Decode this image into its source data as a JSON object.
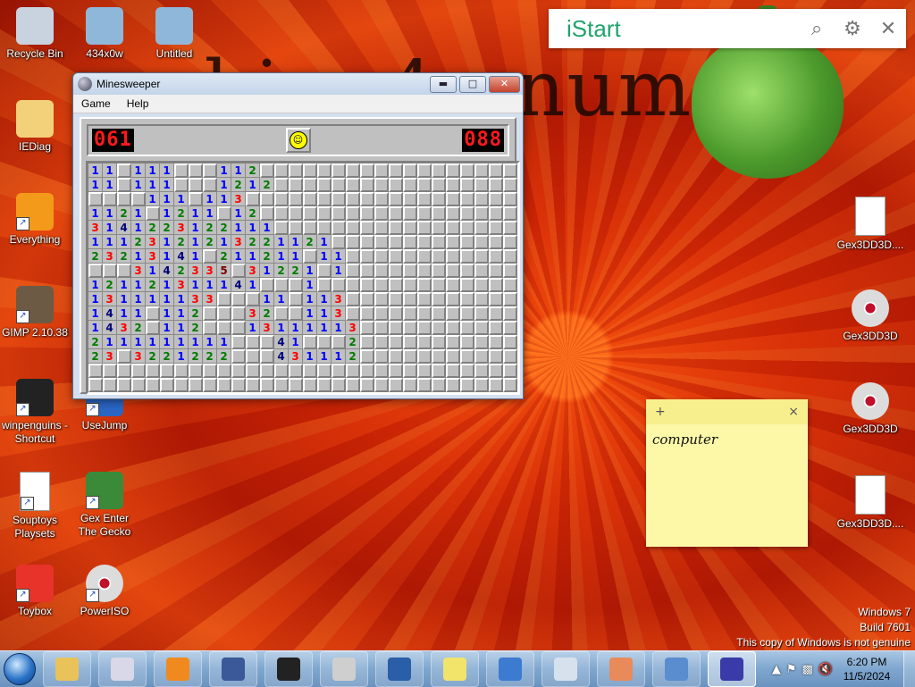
{
  "wallpaper_text": "…hi… 4…num",
  "desktop_icons": [
    {
      "label": "Recycle Bin",
      "icon": "recycle-bin-icon"
    },
    {
      "label": "434x0w",
      "icon": "image-file-icon"
    },
    {
      "label": "Untitled",
      "icon": "image-file-icon"
    },
    {
      "label": "IEDiag",
      "icon": "folder-icon"
    },
    {
      "label": "Everything",
      "icon": "search-app-icon"
    },
    {
      "label": "GIMP 2.10.38",
      "icon": "gimp-icon"
    },
    {
      "label": "winpenguins - Shortcut",
      "icon": "penguin-icon"
    },
    {
      "label": "UseJump",
      "icon": "app-icon"
    },
    {
      "label": "Souptoys Playsets",
      "icon": "document-icon"
    },
    {
      "label": "Gex Enter The Gecko",
      "icon": "gecko-icon"
    },
    {
      "label": "Toybox",
      "icon": "toybox-icon"
    },
    {
      "label": "PowerISO",
      "icon": "disc-icon"
    },
    {
      "label": "Gex3DD3D....",
      "icon": "document-icon"
    },
    {
      "label": "Gex3DD3D",
      "icon": "disc-icon"
    },
    {
      "label": "Gex3DD3D",
      "icon": "disc-icon"
    },
    {
      "label": "Gex3DD3D....",
      "icon": "document-icon"
    }
  ],
  "istart": {
    "logo": "iStart",
    "search_icon": "⌕",
    "settings_icon": "⚙",
    "close_icon": "✕"
  },
  "minesweeper": {
    "title": "Minesweeper",
    "menu": [
      "Game",
      "Help"
    ],
    "mines_left": "061",
    "timer": "088",
    "face": "☺",
    "rows": [
      "11-111---112-----------------",
      "11-111---1212----------------",
      "----111-113------------------",
      "1121-1211-12-----------------",
      "3141223122111-----------------",
      "11123121213221121-------------",
      "23213141-211211-11-----------",
      "---3142335-31221-1-----------",
      "121121311141---1-------------",
      "131111133---11-113-----------",
      "1411-112---32--113-----------",
      "1432-112---13111113-----------",
      "2111111111---41---2----------",
      "23-3221222---431112----------",
      "------------------------------",
      "------------------------------"
    ]
  },
  "sticky_note": {
    "add": "+",
    "close": "×",
    "text": "computer"
  },
  "watermark": [
    "Windows 7",
    "Build 7601",
    "This copy of Windows is not genuine"
  ],
  "taskbar": {
    "buttons": [
      {
        "name": "explorer",
        "color": "#e9c35a"
      },
      {
        "name": "paint-tool",
        "color": "#d8d8e8"
      },
      {
        "name": "media-player",
        "color": "#f08a1e"
      },
      {
        "name": "facebook",
        "color": "#3b5998"
      },
      {
        "name": "ninja-app",
        "color": "#222222"
      },
      {
        "name": "color-wheel",
        "color": "#cfcfcf"
      },
      {
        "name": "gecko-app",
        "color": "#2a5ea8"
      },
      {
        "name": "sticky-notes",
        "color": "#f2e36b"
      },
      {
        "name": "remote-desktop",
        "color": "#3c7bd0"
      },
      {
        "name": "calculator",
        "color": "#d7e1ee"
      },
      {
        "name": "paint",
        "color": "#e88a5a"
      },
      {
        "name": "magnifier",
        "color": "#5a8cd0"
      },
      {
        "name": "minesweeper",
        "color": "#3a3aa8"
      }
    ],
    "time": "6:20 PM",
    "date": "11/5/2024"
  }
}
